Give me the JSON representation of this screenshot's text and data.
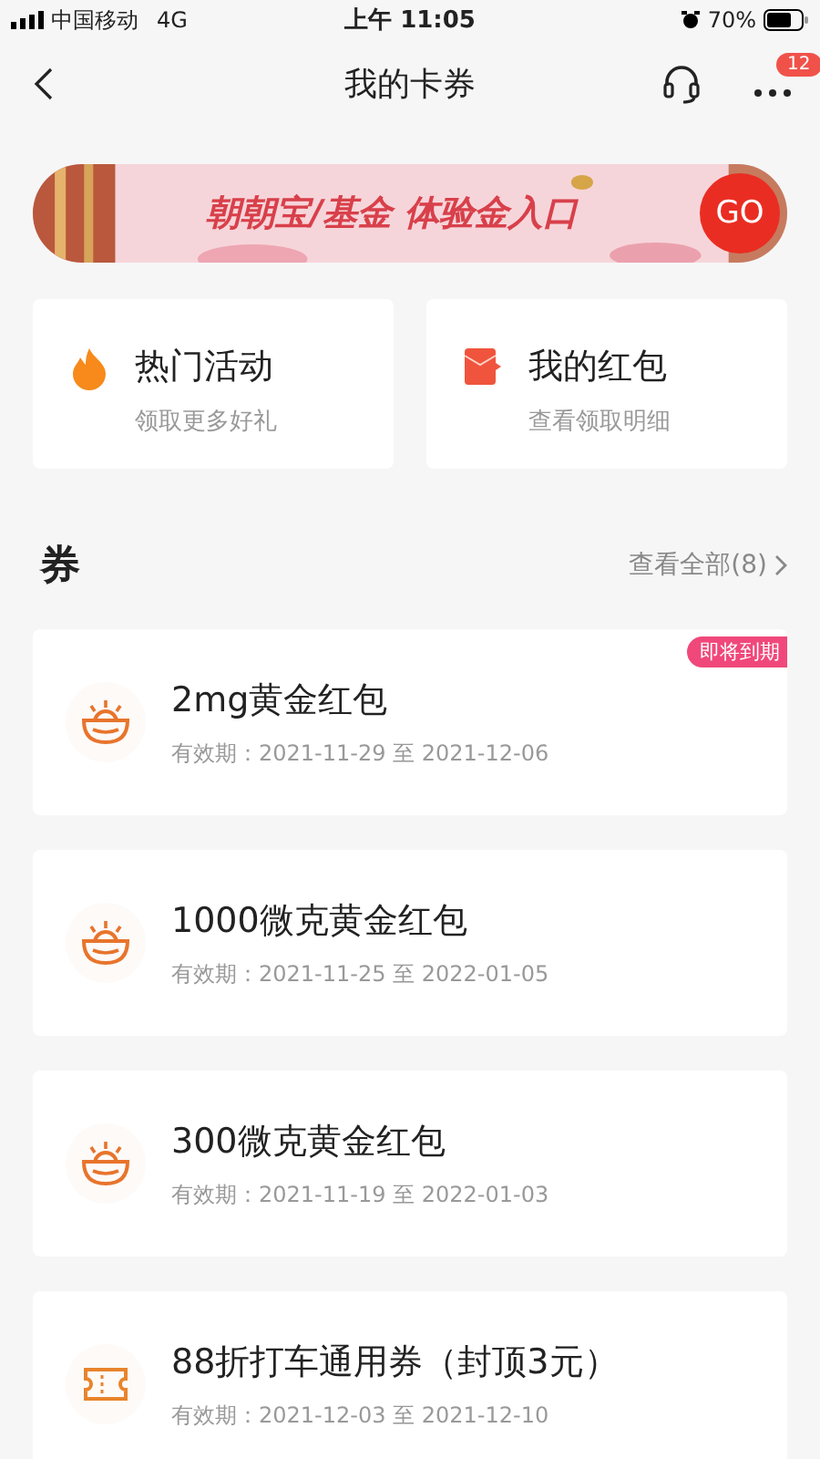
{
  "status_bar": {
    "carrier": "中国移动",
    "network": "4G",
    "time": "上午 11:05",
    "battery": "70%"
  },
  "nav": {
    "title": "我的卡券",
    "badge": "12"
  },
  "banner": {
    "text": "朝朝宝/基金 体验金入口",
    "button": "GO"
  },
  "shortcuts": [
    {
      "kind": "fire",
      "title": "热门活动",
      "subtitle": "领取更多好礼"
    },
    {
      "kind": "envelope",
      "title": "我的红包",
      "subtitle": "查看领取明细"
    }
  ],
  "section": {
    "title": "券",
    "link": "查看全部(8)"
  },
  "coupons": [
    {
      "kind": "gold",
      "title": "2mg黄金红包",
      "validity": "有效期：2021-11-29 至 2021-12-06",
      "tag": "即将到期"
    },
    {
      "kind": "gold",
      "title": "1000微克黄金红包",
      "validity": "有效期：2021-11-25 至 2022-01-05"
    },
    {
      "kind": "gold",
      "title": "300微克黄金红包",
      "validity": "有效期：2021-11-19 至 2022-01-03"
    },
    {
      "kind": "ticket",
      "title": "88折打车通用券（封顶3元）",
      "validity": "有效期：2021-12-03 至 2021-12-10"
    }
  ]
}
